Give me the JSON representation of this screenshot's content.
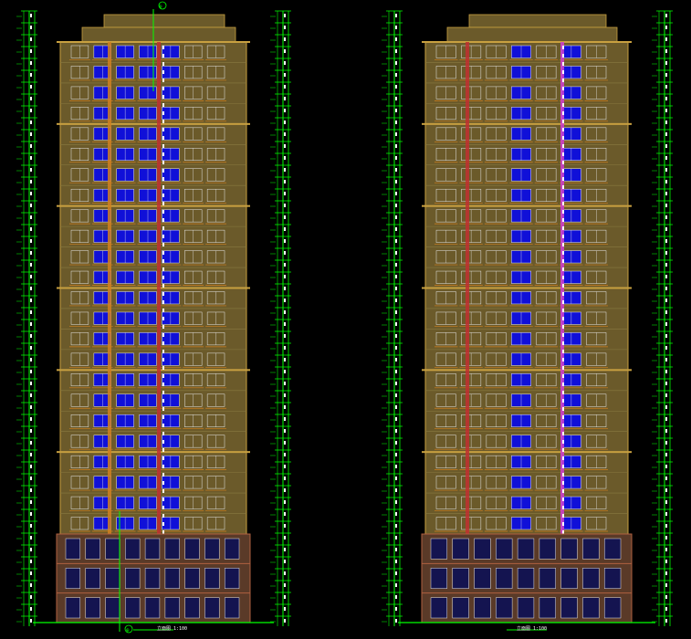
{
  "drawing": {
    "background": "#000000",
    "colors": {
      "dimension": "#00ff00",
      "facade": "#6b5a2a",
      "facade_edge": "#c8a040",
      "window_glass": "#1010d8",
      "window_frame": "#e8e8e8",
      "balcony_rail": "#d08020",
      "podium": "#5a3a28",
      "podium_brick": "#b06040",
      "floor_line": "#8a7a40",
      "accent_red": "#c03030",
      "accent_magenta": "#d040d0",
      "stair_white": "#ffffff"
    },
    "elevations": [
      {
        "id": "left-elevation",
        "caption": "立面图 1:100",
        "axis_tag_top": "⊕",
        "axis_tag_bottom": "⊕",
        "floors": 24,
        "podium_floors": 3
      },
      {
        "id": "right-elevation",
        "caption": "立面图 1:100",
        "floors": 24,
        "podium_floors": 3
      }
    ]
  }
}
